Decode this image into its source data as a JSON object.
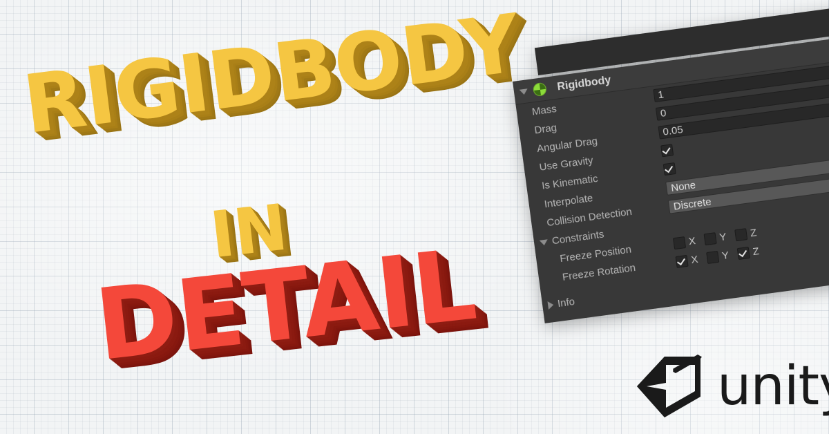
{
  "background": {
    "style": "graph-paper",
    "base_color": "#f2f4f5",
    "grid_line_color": "#96a5b4"
  },
  "headline": {
    "line1": "RIGIDBODY",
    "line2": "IN",
    "line3": "DETAIL",
    "line1_color": "#F5C642",
    "line1_shadow_color": "#A07916",
    "line2_color": "#F5C642",
    "line2_shadow_color": "#A07916",
    "line3_color": "#F4483A",
    "line3_shadow_color": "#8B1A10"
  },
  "inspector": {
    "toolbar": {
      "help_icon": "help-question-icon",
      "settings_icon": "settings-sliders-icon",
      "menu_icon": "kebab-menu-icon"
    },
    "component": {
      "title": "Rigidbody",
      "icon": "rigidbody-physics-icon",
      "icon_color": "#8CDB3A",
      "expanded": true,
      "expand_arrow": "chevron-down-icon"
    },
    "properties": [
      {
        "label": "Mass",
        "type": "number",
        "value": "1"
      },
      {
        "label": "Drag",
        "type": "number",
        "value": "0"
      },
      {
        "label": "Angular Drag",
        "type": "number",
        "value": "0.05"
      },
      {
        "label": "Use Gravity",
        "type": "checkbox",
        "checked": true
      },
      {
        "label": "Is Kinematic",
        "type": "checkbox",
        "checked": true
      },
      {
        "label": "Interpolate",
        "type": "dropdown",
        "value": "None"
      },
      {
        "label": "Collision Detection",
        "type": "dropdown",
        "value": "Discrete"
      }
    ],
    "constraints": {
      "label": "Constraints",
      "expanded": true,
      "expand_arrow": "chevron-down-icon",
      "freeze_position": {
        "label": "Freeze Position",
        "axes": [
          {
            "axis": "X",
            "checked": false
          },
          {
            "axis": "Y",
            "checked": false
          },
          {
            "axis": "Z",
            "checked": false
          }
        ]
      },
      "freeze_rotation": {
        "label": "Freeze Rotation",
        "axes": [
          {
            "axis": "X",
            "checked": true
          },
          {
            "axis": "Y",
            "checked": false
          },
          {
            "axis": "Z",
            "checked": true
          }
        ]
      }
    },
    "info": {
      "label": "Info",
      "expanded": false,
      "expand_arrow": "chevron-right-icon"
    },
    "colors": {
      "panel_bg": "#383838",
      "header_bg": "#3c3c3c",
      "toolbar_bg": "#2d2d2d",
      "field_bg": "#282828",
      "dropdown_bg": "#585858",
      "label_text": "#b5b5b5",
      "value_text": "#cfcfcf"
    }
  },
  "branding": {
    "wordmark": "unity",
    "logo_icon": "unity-cube-icon",
    "color": "#1a1a1a"
  }
}
